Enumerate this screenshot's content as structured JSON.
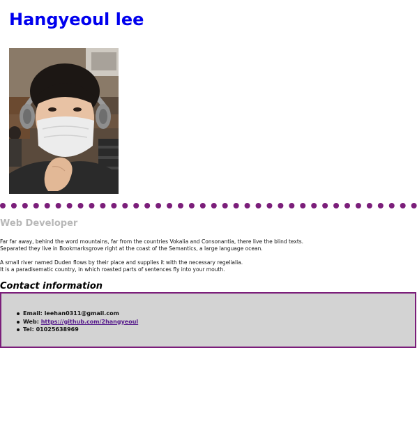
{
  "header": {
    "name": "Hangyeoul lee"
  },
  "profile": {
    "photo_icon": "profile-photo",
    "job_title": "Web Developer",
    "intro": {
      "p1_line1": "Far far away, behind the word mountains, far from the countries Vokalia and Consonantia, there live the blind texts.",
      "p1_line2": "Separated they live in Bookmarksgrove right at the coast of the Semantics, a large language ocean.",
      "p2_line1": "A small river named Duden flows by their place and supplies it with the necessary regelialia.",
      "p2_line2": "It is a paradisematic country, in which roasted parts of sentences fly into your mouth."
    }
  },
  "contact": {
    "heading": "Contact information",
    "email_label": "Email:",
    "email_value": "leehan0311@gmail.com",
    "web_label": "Web:",
    "web_value": "https://github.com/2hangyeoul",
    "tel_label": "Tel:",
    "tel_value": "01025638969"
  },
  "colors": {
    "heading": "#0000ee",
    "divider": "#7b1e7a",
    "job_title": "#b8b8b8",
    "contact_bg": "#d3d3d3",
    "contact_border": "#7b1e7a",
    "link": "#551a8b"
  }
}
